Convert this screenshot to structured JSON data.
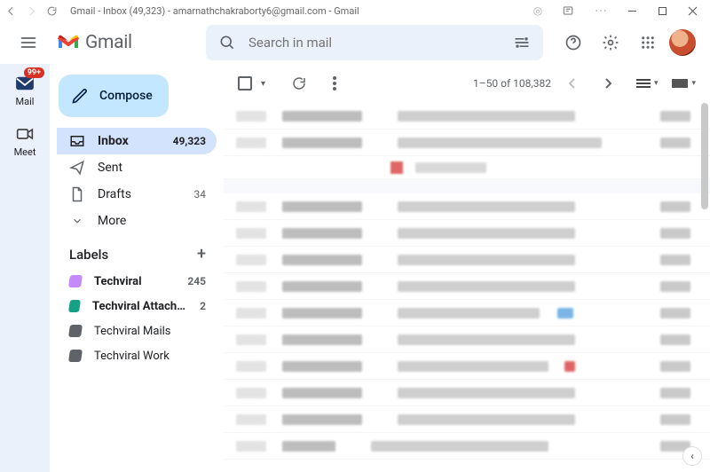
{
  "window": {
    "title": "Gmail - Inbox (49,323) - amarnathchakraborty6@gmail.com - Gmail"
  },
  "header": {
    "app_name": "Gmail",
    "search_placeholder": "Search in mail"
  },
  "rail": {
    "mail_label": "Mail",
    "mail_badge": "99+",
    "meet_label": "Meet"
  },
  "sidebar": {
    "compose_label": "Compose",
    "items": [
      {
        "label": "Inbox",
        "count": "49,323",
        "active": true
      },
      {
        "label": "Sent",
        "count": "",
        "active": false
      },
      {
        "label": "Drafts",
        "count": "34",
        "active": false
      },
      {
        "label": "More",
        "count": "",
        "active": false
      }
    ],
    "labels_heading": "Labels",
    "labels": [
      {
        "name": "Techviral",
        "count": "245",
        "bold": true,
        "color": "#c58af9"
      },
      {
        "name": "Techviral Attachme...",
        "count": "2",
        "bold": true,
        "color": "#16a085"
      },
      {
        "name": "Techviral Mails",
        "count": "",
        "bold": false,
        "color": "#5f6368"
      },
      {
        "name": "Techviral Work",
        "count": "",
        "bold": false,
        "color": "#5f6368"
      }
    ]
  },
  "toolbar": {
    "range_text": "1–50 of 108,382"
  }
}
